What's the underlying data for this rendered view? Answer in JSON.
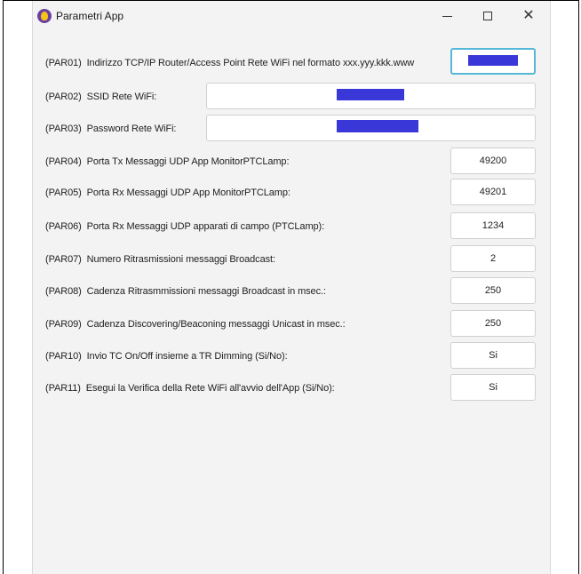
{
  "window": {
    "title": "Parametri App"
  },
  "params": [
    {
      "code": "(PAR01)",
      "label": "Indirizzo TCP/IP Router/Access Point Rete WiFi nel formato xxx.yyy.kkk.www",
      "value": ""
    },
    {
      "code": "(PAR02)",
      "label": "SSID Rete WiFi:",
      "value": ""
    },
    {
      "code": "(PAR03)",
      "label": "Password Rete WiFi:",
      "value": ""
    },
    {
      "code": "(PAR04)",
      "label": "Porta Tx Messaggi UDP App MonitorPTCLamp:",
      "value": "49200"
    },
    {
      "code": "(PAR05)",
      "label": "Porta Rx Messaggi UDP App MonitorPTCLamp:",
      "value": "49201"
    },
    {
      "code": "(PAR06)",
      "label": "Porta Rx Messaggi UDP apparati di campo (PTCLamp):",
      "value": "1234"
    },
    {
      "code": "(PAR07)",
      "label": "Numero Ritrasmissioni messaggi Broadcast:",
      "value": "2"
    },
    {
      "code": "(PAR08)",
      "label": "Cadenza Ritrasmmissioni messaggi Broadcast in msec.:",
      "value": "250"
    },
    {
      "code": "(PAR09)",
      "label": "Cadenza Discovering/Beaconing messaggi Unicast in msec.:",
      "value": "250"
    },
    {
      "code": "(PAR10)",
      "label": "Invio TC On/Off insieme a TR Dimming (Si/No):",
      "value": "Si"
    },
    {
      "code": "(PAR11)",
      "label": "Esegui la Verifica della Rete WiFi all'avvio dell'App (Si/No):",
      "value": "Si"
    }
  ],
  "colors": {
    "background": "#f3f3f3",
    "focus_border": "#55b8d8",
    "redaction": "#3a37d8"
  }
}
